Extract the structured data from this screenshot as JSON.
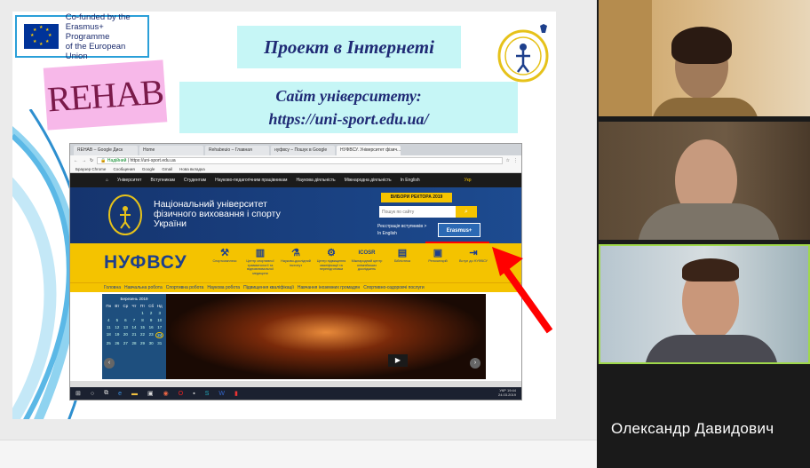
{
  "slide": {
    "eu_text": [
      "Co-funded by the",
      "Erasmus+ Programme",
      "of the European Union"
    ],
    "title1": "Проект в Інтернеті",
    "title2_line1": "Сайт університету:",
    "title2_line2": "https://uni-sport.edu.ua/",
    "rehab": "REHAB"
  },
  "browser": {
    "tabs": [
      "REHAB – Google Диск",
      "Home",
      "Rehabeuio – Главная",
      "нуфвсу – Пошук в Google",
      "НУФВСУ. Університет фізич..."
    ],
    "address": "https://uni-sport.edu.ua",
    "secure_label": "Надійний",
    "bookmarks": [
      "Браузер Chrome",
      "Сообщения",
      "Google",
      "Gmail",
      "Нова вкладка"
    ],
    "site_menu": [
      "Університет",
      "Вступникам",
      "Студентам",
      "Науково-педагогічним працівникам",
      "Наукова діяльність",
      "Міжнародна діяльність",
      "In English"
    ],
    "site_lang": "Укр",
    "site_name": [
      "Національний університет",
      "фізичного виховання і спорту",
      "України"
    ],
    "vybory": "ВИБОРИ РЕКТОРА 2019",
    "search_placeholder": "Пошук по сайту",
    "reg_links": [
      "Реєстрація вступників >",
      "In English"
    ],
    "erasmus": "Erasmus+",
    "nufvsu": "НУФВСУ",
    "icons": [
      {
        "label": "Спорткомплекс"
      },
      {
        "label": "Центр спортивної травматології та відновлювальної медицини"
      },
      {
        "label": "Науково-дослідний інститут"
      },
      {
        "label": "Центр підвищення кваліфікації та перепідготовки"
      },
      {
        "label": "Міжнародний центр олімпійських досліджень",
        "glyph": "ICOSR"
      },
      {
        "label": "Бібліотека"
      },
      {
        "label": "Репозитарій"
      },
      {
        "label": "Вступ до НУФВСУ"
      }
    ],
    "crumbs": [
      "Головна",
      "Навчальна робота",
      "Спортивна робота",
      "Наукова робота",
      "Підвищення кваліфікації",
      "Навчання іноземних громадян",
      "Спортивно-оздоровчі послуги"
    ],
    "calendar": {
      "month": "Березень 2019",
      "days_head": [
        "Пн",
        "Вт",
        "Ср",
        "Чт",
        "Пт",
        "Сб",
        "Нд"
      ],
      "days": [
        "",
        "",
        "",
        "",
        "1",
        "2",
        "3",
        "4",
        "5",
        "6",
        "7",
        "8",
        "9",
        "10",
        "11",
        "12",
        "13",
        "14",
        "15",
        "16",
        "17",
        "18",
        "19",
        "20",
        "21",
        "22",
        "23",
        "24",
        "25",
        "26",
        "27",
        "28",
        "29",
        "30",
        "31"
      ]
    },
    "taskbar_lang": "УКР",
    "taskbar_time": "19:44",
    "taskbar_date": "24.03.2019"
  },
  "participants": [
    {
      "name": ""
    },
    {
      "name": ""
    },
    {
      "name": ""
    },
    {
      "name": "Олександр Давидович"
    }
  ]
}
